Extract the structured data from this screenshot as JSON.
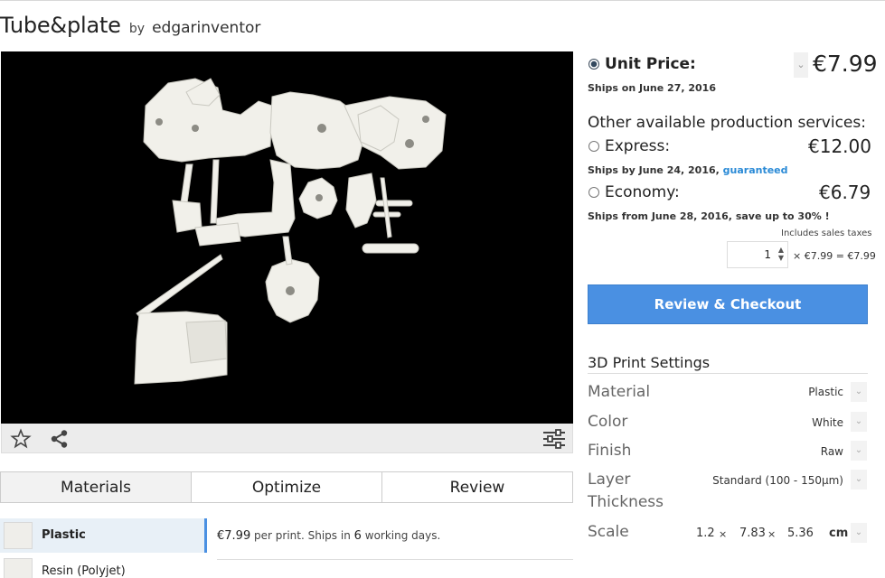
{
  "header": {
    "title": "Tube&plate",
    "by": "by",
    "author": "edgarinventor"
  },
  "viewer": {
    "icons": [
      "star-icon",
      "share-icon",
      "settings-sliders-icon"
    ]
  },
  "tabs": [
    {
      "label": "Materials",
      "active": true
    },
    {
      "label": "Optimize",
      "active": false
    },
    {
      "label": "Review",
      "active": false
    }
  ],
  "materials": [
    {
      "name": "Plastic",
      "selected": true,
      "price": "€7.99",
      "per_print": "per print. Ships in",
      "days": "6",
      "days_suffix": "working days."
    },
    {
      "name": "Resin (Polyjet)",
      "selected": false
    }
  ],
  "pricing": {
    "unit_label": "Unit Price:",
    "unit_price": "€7.99",
    "unit_ships": "Ships on June 27, 2016",
    "other_label": "Other available production services:",
    "express_label": "Express:",
    "express_price": "€12.00",
    "express_ships": "Ships by June 24, 2016,",
    "express_guaranteed": "guaranteed",
    "economy_label": "Economy:",
    "economy_price": "€6.79",
    "economy_ships": "Ships from June 28, 2016, save up to 30% !",
    "tax_note": "Includes sales taxes",
    "quantity": "1",
    "calc": "× €7.99 = €7.99"
  },
  "checkout_label": "Review & Checkout",
  "settings": {
    "title": "3D Print Settings",
    "material_label": "Material",
    "material_value": "Plastic",
    "color_label": "Color",
    "color_value": "White",
    "finish_label": "Finish",
    "finish_value": "Raw",
    "layer_label_1": "Layer",
    "layer_label_2": "Thickness",
    "layer_value": "Standard (100 - 150µm)",
    "scale_label": "Scale",
    "scale_x": "1.2",
    "scale_y": "7.83",
    "scale_z": "5.36",
    "scale_times": "×",
    "scale_unit": "cm"
  },
  "colors": {
    "accent": "#4a90e2",
    "link": "#2a8ad6",
    "viewer_bg": "#000000",
    "model": "#f1f0ea"
  }
}
